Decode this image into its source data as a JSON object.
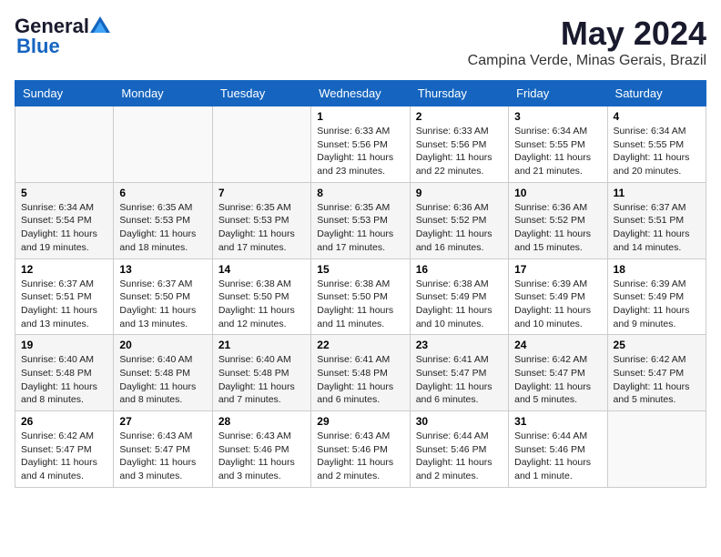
{
  "header": {
    "logo_general": "General",
    "logo_blue": "Blue",
    "month_title": "May 2024",
    "location": "Campina Verde, Minas Gerais, Brazil"
  },
  "weekdays": [
    "Sunday",
    "Monday",
    "Tuesday",
    "Wednesday",
    "Thursday",
    "Friday",
    "Saturday"
  ],
  "weeks": [
    [
      {
        "day": null,
        "info": null
      },
      {
        "day": null,
        "info": null
      },
      {
        "day": null,
        "info": null
      },
      {
        "day": "1",
        "info": "Sunrise: 6:33 AM\nSunset: 5:56 PM\nDaylight: 11 hours\nand 23 minutes."
      },
      {
        "day": "2",
        "info": "Sunrise: 6:33 AM\nSunset: 5:56 PM\nDaylight: 11 hours\nand 22 minutes."
      },
      {
        "day": "3",
        "info": "Sunrise: 6:34 AM\nSunset: 5:55 PM\nDaylight: 11 hours\nand 21 minutes."
      },
      {
        "day": "4",
        "info": "Sunrise: 6:34 AM\nSunset: 5:55 PM\nDaylight: 11 hours\nand 20 minutes."
      }
    ],
    [
      {
        "day": "5",
        "info": "Sunrise: 6:34 AM\nSunset: 5:54 PM\nDaylight: 11 hours\nand 19 minutes."
      },
      {
        "day": "6",
        "info": "Sunrise: 6:35 AM\nSunset: 5:53 PM\nDaylight: 11 hours\nand 18 minutes."
      },
      {
        "day": "7",
        "info": "Sunrise: 6:35 AM\nSunset: 5:53 PM\nDaylight: 11 hours\nand 17 minutes."
      },
      {
        "day": "8",
        "info": "Sunrise: 6:35 AM\nSunset: 5:53 PM\nDaylight: 11 hours\nand 17 minutes."
      },
      {
        "day": "9",
        "info": "Sunrise: 6:36 AM\nSunset: 5:52 PM\nDaylight: 11 hours\nand 16 minutes."
      },
      {
        "day": "10",
        "info": "Sunrise: 6:36 AM\nSunset: 5:52 PM\nDaylight: 11 hours\nand 15 minutes."
      },
      {
        "day": "11",
        "info": "Sunrise: 6:37 AM\nSunset: 5:51 PM\nDaylight: 11 hours\nand 14 minutes."
      }
    ],
    [
      {
        "day": "12",
        "info": "Sunrise: 6:37 AM\nSunset: 5:51 PM\nDaylight: 11 hours\nand 13 minutes."
      },
      {
        "day": "13",
        "info": "Sunrise: 6:37 AM\nSunset: 5:50 PM\nDaylight: 11 hours\nand 13 minutes."
      },
      {
        "day": "14",
        "info": "Sunrise: 6:38 AM\nSunset: 5:50 PM\nDaylight: 11 hours\nand 12 minutes."
      },
      {
        "day": "15",
        "info": "Sunrise: 6:38 AM\nSunset: 5:50 PM\nDaylight: 11 hours\nand 11 minutes."
      },
      {
        "day": "16",
        "info": "Sunrise: 6:38 AM\nSunset: 5:49 PM\nDaylight: 11 hours\nand 10 minutes."
      },
      {
        "day": "17",
        "info": "Sunrise: 6:39 AM\nSunset: 5:49 PM\nDaylight: 11 hours\nand 10 minutes."
      },
      {
        "day": "18",
        "info": "Sunrise: 6:39 AM\nSunset: 5:49 PM\nDaylight: 11 hours\nand 9 minutes."
      }
    ],
    [
      {
        "day": "19",
        "info": "Sunrise: 6:40 AM\nSunset: 5:48 PM\nDaylight: 11 hours\nand 8 minutes."
      },
      {
        "day": "20",
        "info": "Sunrise: 6:40 AM\nSunset: 5:48 PM\nDaylight: 11 hours\nand 8 minutes."
      },
      {
        "day": "21",
        "info": "Sunrise: 6:40 AM\nSunset: 5:48 PM\nDaylight: 11 hours\nand 7 minutes."
      },
      {
        "day": "22",
        "info": "Sunrise: 6:41 AM\nSunset: 5:48 PM\nDaylight: 11 hours\nand 6 minutes."
      },
      {
        "day": "23",
        "info": "Sunrise: 6:41 AM\nSunset: 5:47 PM\nDaylight: 11 hours\nand 6 minutes."
      },
      {
        "day": "24",
        "info": "Sunrise: 6:42 AM\nSunset: 5:47 PM\nDaylight: 11 hours\nand 5 minutes."
      },
      {
        "day": "25",
        "info": "Sunrise: 6:42 AM\nSunset: 5:47 PM\nDaylight: 11 hours\nand 5 minutes."
      }
    ],
    [
      {
        "day": "26",
        "info": "Sunrise: 6:42 AM\nSunset: 5:47 PM\nDaylight: 11 hours\nand 4 minutes."
      },
      {
        "day": "27",
        "info": "Sunrise: 6:43 AM\nSunset: 5:47 PM\nDaylight: 11 hours\nand 3 minutes."
      },
      {
        "day": "28",
        "info": "Sunrise: 6:43 AM\nSunset: 5:46 PM\nDaylight: 11 hours\nand 3 minutes."
      },
      {
        "day": "29",
        "info": "Sunrise: 6:43 AM\nSunset: 5:46 PM\nDaylight: 11 hours\nand 2 minutes."
      },
      {
        "day": "30",
        "info": "Sunrise: 6:44 AM\nSunset: 5:46 PM\nDaylight: 11 hours\nand 2 minutes."
      },
      {
        "day": "31",
        "info": "Sunrise: 6:44 AM\nSunset: 5:46 PM\nDaylight: 11 hours\nand 1 minute."
      },
      {
        "day": null,
        "info": null
      }
    ]
  ]
}
